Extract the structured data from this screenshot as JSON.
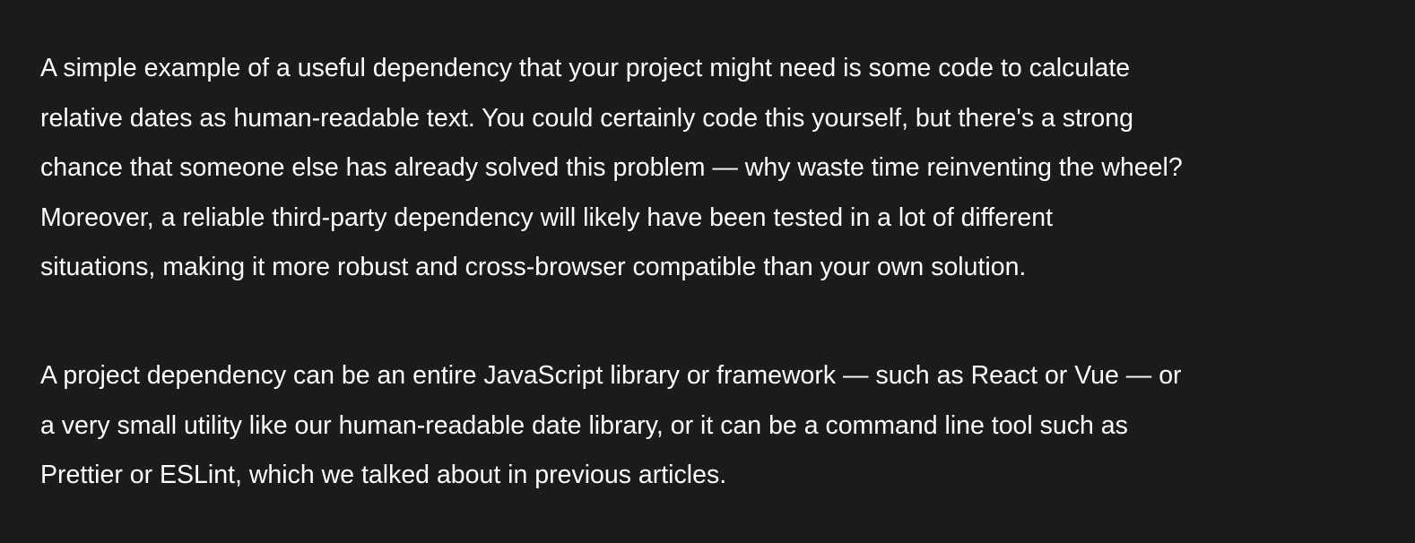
{
  "article": {
    "paragraphs": [
      {
        "lines": [
          "A simple example of a useful dependency that your project might need is some code to calculate",
          "relative dates as human-readable text. You could certainly code this yourself, but there's a strong",
          "chance that someone else has already solved this problem — why waste time reinventing the wheel?",
          "Moreover, a reliable third-party dependency will likely have been tested in a lot of different",
          "situations, making it more robust and cross-browser compatible than your own solution."
        ]
      },
      {
        "lines": [
          "A project dependency can be an entire JavaScript library or framework — such as React or Vue — or",
          "a very small utility like our human-readable date library, or it can be a command line tool such as",
          "Prettier or ESLint, which we talked about in previous articles."
        ]
      }
    ]
  }
}
